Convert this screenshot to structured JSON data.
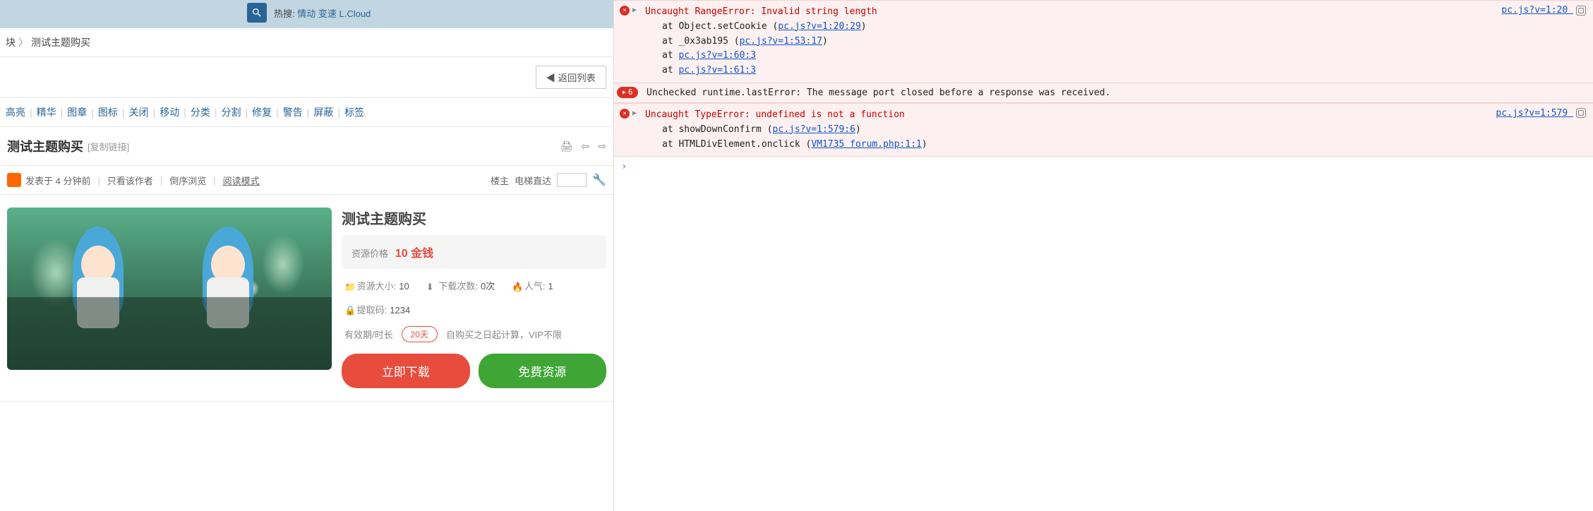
{
  "search": {
    "hot_prefix": "热搜:",
    "hot_items": "情动 变速 L.Cloud"
  },
  "breadcrumb": {
    "item1": "块",
    "item2": "测试主题购买"
  },
  "back_btn": "◀ 返回列表",
  "admin_links": [
    "高亮",
    "精华",
    "图章",
    "图标",
    "关闭",
    "移动",
    "分类",
    "分割",
    "修复",
    "警告",
    "屏蔽",
    "标签"
  ],
  "title": "测试主题购买",
  "copy_link": "[复制链接]",
  "post_meta": {
    "posted": "发表于 4 分钟前",
    "only_author": "只看该作者",
    "reverse": "倒序浏览",
    "read_mode": "阅读模式",
    "floor": "楼主",
    "elevator": "电梯直达"
  },
  "resource": {
    "title": "测试主题购买",
    "price_label": "资源价格",
    "price_value": "10 金钱",
    "size_label": "资源大小:",
    "size_value": "10",
    "downloads_label": "下载次数:",
    "downloads_value": "0次",
    "pop_label": "人气:",
    "pop_value": "1",
    "code_label": "提取码:",
    "code_value": "1234",
    "validity_label": "有效期/时长",
    "validity_value": "20天",
    "validity_note": "自购买之日起计算，VIP不限",
    "btn_download": "立即下载",
    "btn_free": "免费资源"
  },
  "console": {
    "err1": {
      "head": "Uncaught RangeError: Invalid string length",
      "source": "pc.js?v=1:20",
      "stack": [
        {
          "prefix": "at Object.setCookie (",
          "link": "pc.js?v=1:20:29",
          "suffix": ")"
        },
        {
          "prefix": "at _0x3ab195 (",
          "link": "pc.js?v=1:53:17",
          "suffix": ")"
        },
        {
          "prefix": "at ",
          "link": "pc.js?v=1:60:3",
          "suffix": ""
        },
        {
          "prefix": "at ",
          "link": "pc.js?v=1:61:3",
          "suffix": ""
        }
      ]
    },
    "warn": {
      "count": "6",
      "text": "Unchecked runtime.lastError: The message port closed before a response was received."
    },
    "err2": {
      "head": "Uncaught TypeError: undefined is not a function",
      "source": "pc.js?v=1:579",
      "stack": [
        {
          "prefix": "at showDownConfirm (",
          "link": "pc.js?v=1:579:6",
          "suffix": ")"
        },
        {
          "prefix": "at HTMLDivElement.onclick (",
          "link": "VM1735 forum.php:1:1",
          "suffix": ")"
        }
      ]
    }
  }
}
